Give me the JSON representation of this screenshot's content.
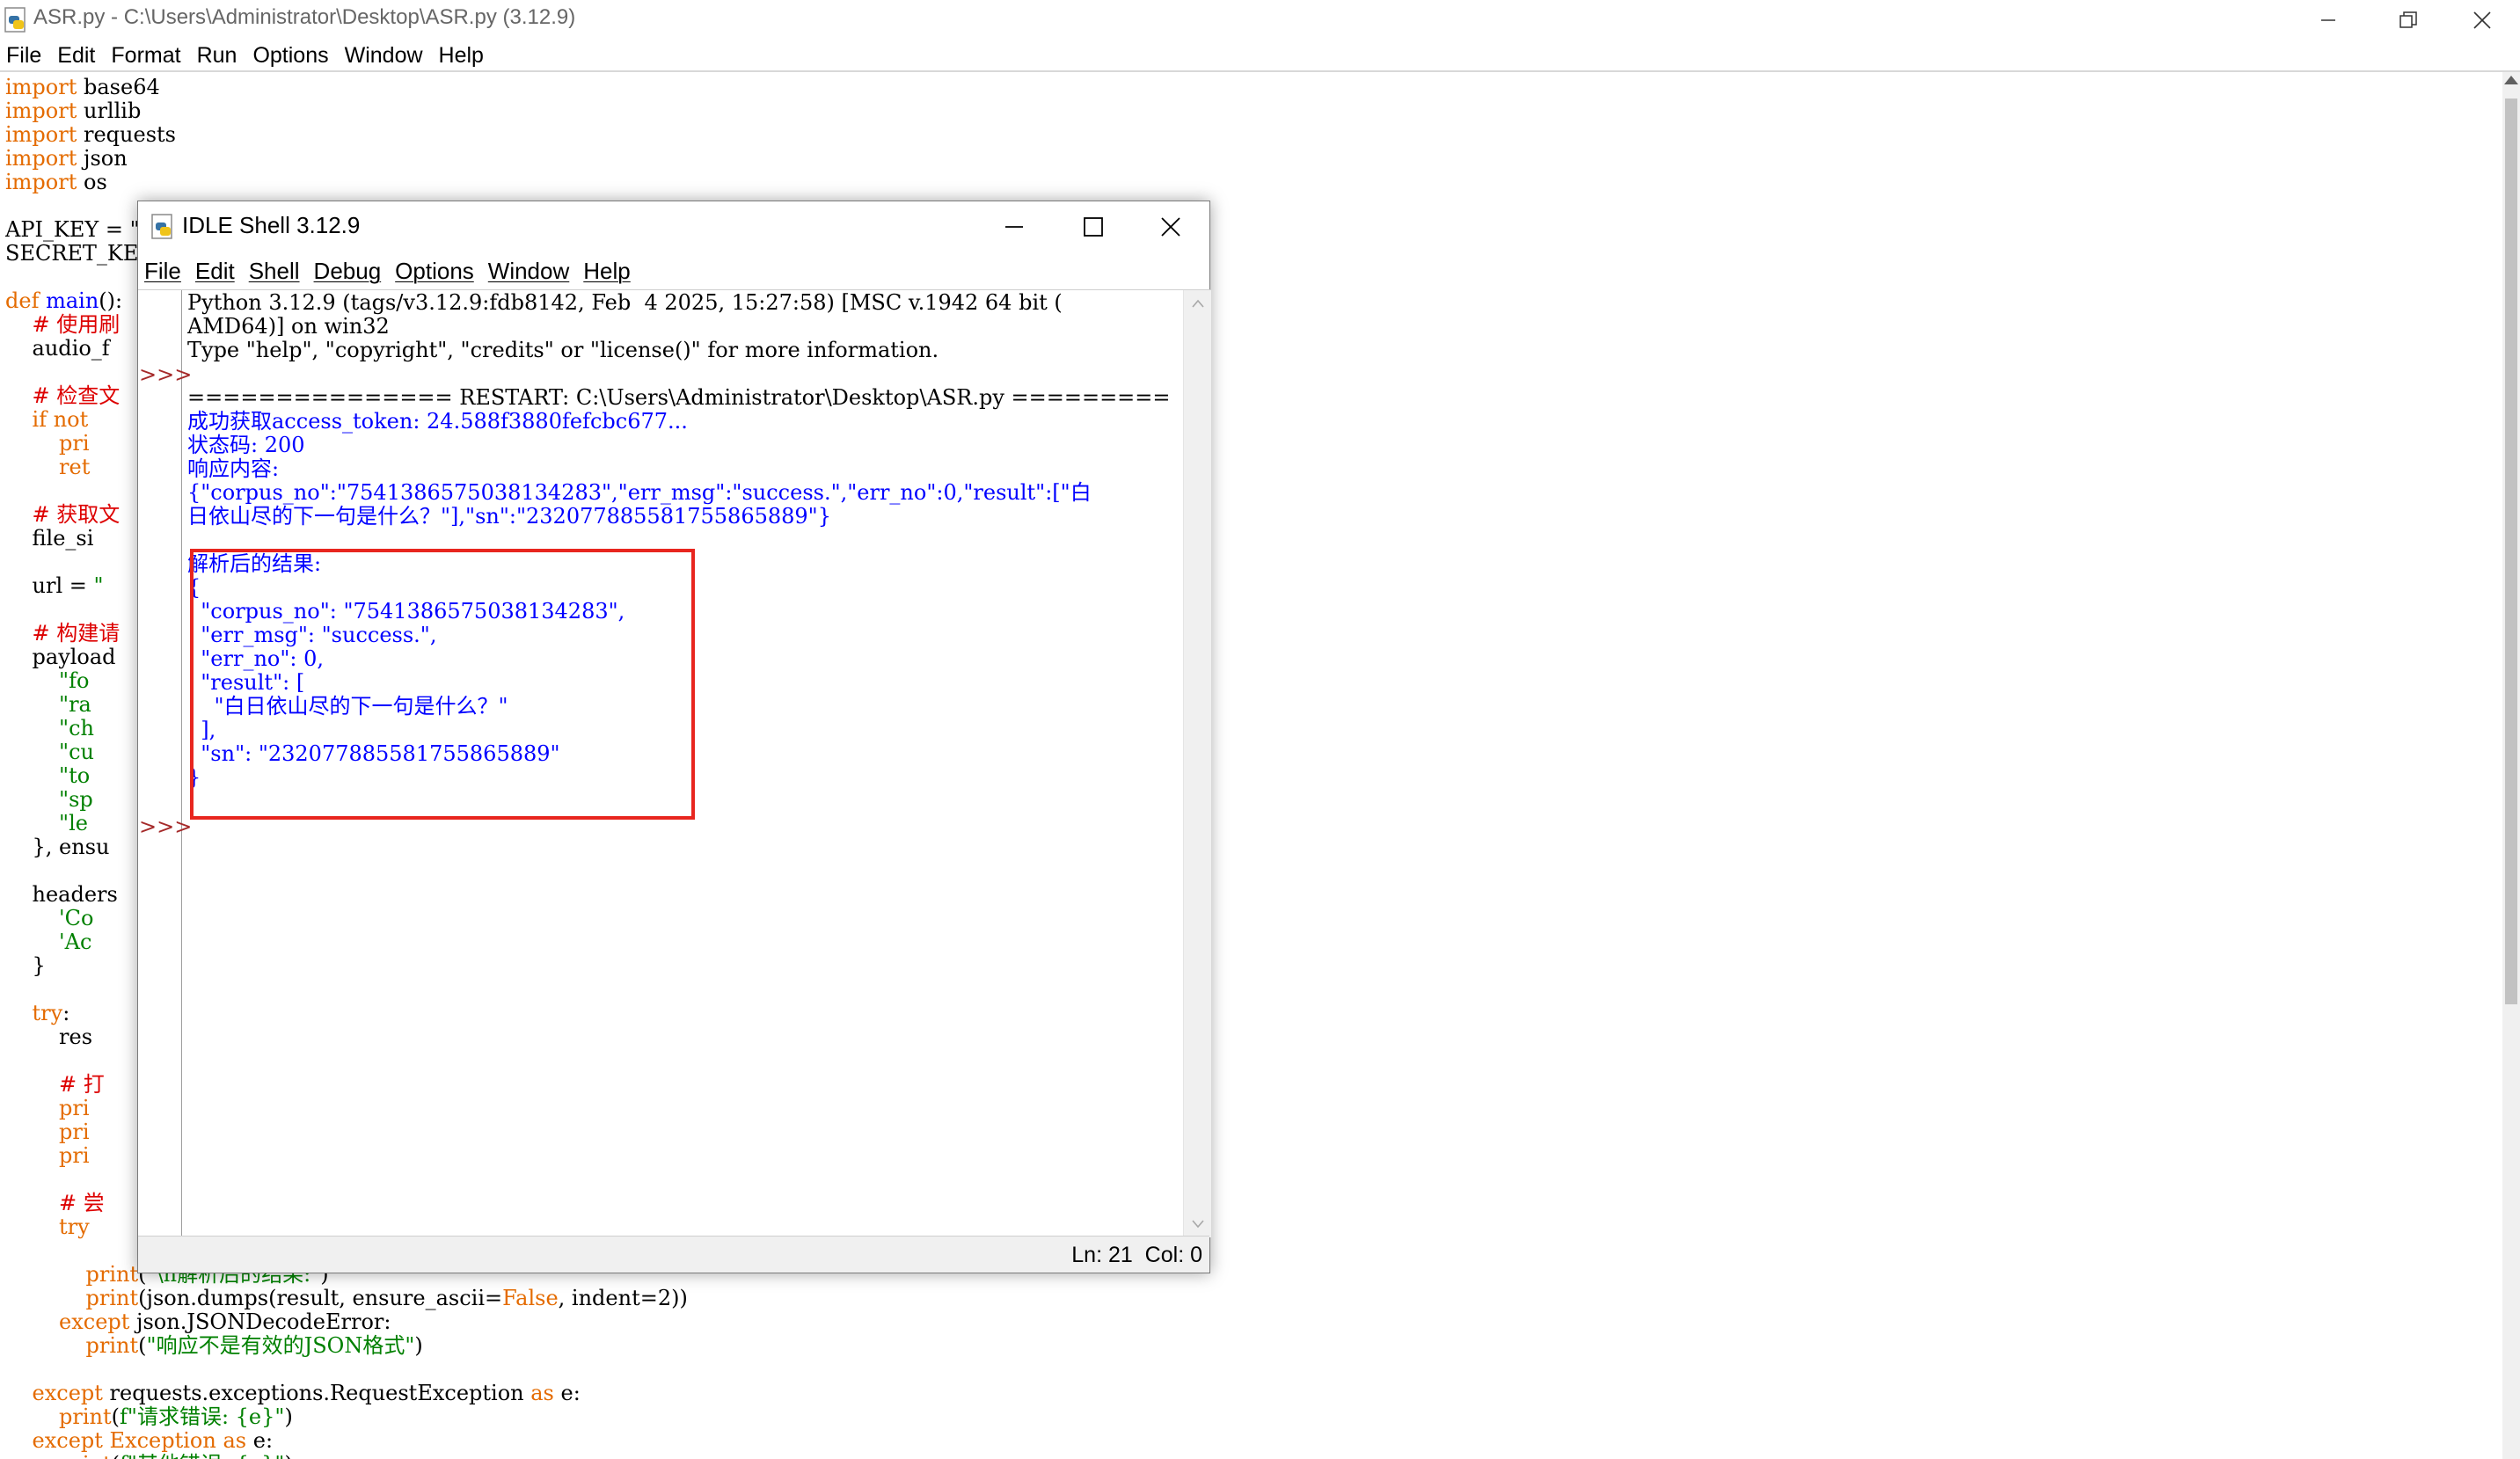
{
  "editor": {
    "title": "ASR.py - C:\\Users\\Administrator\\Desktop\\ASR.py (3.12.9)",
    "menu": [
      "File",
      "Edit",
      "Format",
      "Run",
      "Options",
      "Window",
      "Help"
    ],
    "code_lines": [
      [
        {
          "c": "kw",
          "t": "import"
        },
        {
          "c": "plain",
          "t": " base64"
        }
      ],
      [
        {
          "c": "kw",
          "t": "import"
        },
        {
          "c": "plain",
          "t": " urllib"
        }
      ],
      [
        {
          "c": "kw",
          "t": "import"
        },
        {
          "c": "plain",
          "t": " requests"
        }
      ],
      [
        {
          "c": "kw",
          "t": "import"
        },
        {
          "c": "plain",
          "t": " json"
        }
      ],
      [
        {
          "c": "kw",
          "t": "import"
        },
        {
          "c": "plain",
          "t": " os"
        }
      ],
      [],
      [
        {
          "c": "plain",
          "t": "API_KEY = \""
        }
      ],
      [
        {
          "c": "plain",
          "t": "SECRET_KEY"
        }
      ],
      [],
      [
        {
          "c": "kw",
          "t": "def"
        },
        {
          "c": "plain",
          "t": " "
        },
        {
          "c": "fn",
          "t": "main"
        },
        {
          "c": "plain",
          "t": "():"
        }
      ],
      [
        {
          "c": "cm",
          "t": "    # 使用刷"
        }
      ],
      [
        {
          "c": "plain",
          "t": "    audio_f"
        }
      ],
      [],
      [
        {
          "c": "cm",
          "t": "    # 检查文"
        }
      ],
      [
        {
          "c": "kw",
          "t": "    if not"
        }
      ],
      [
        {
          "c": "kw",
          "t": "        pri"
        }
      ],
      [
        {
          "c": "kw",
          "t": "        ret"
        }
      ],
      [],
      [
        {
          "c": "cm",
          "t": "    # 获取文"
        }
      ],
      [
        {
          "c": "plain",
          "t": "    file_si"
        }
      ],
      [],
      [
        {
          "c": "plain",
          "t": "    url = "
        },
        {
          "c": "st",
          "t": "\""
        }
      ],
      [],
      [
        {
          "c": "cm",
          "t": "    # 构建请"
        }
      ],
      [
        {
          "c": "plain",
          "t": "    payload"
        }
      ],
      [
        {
          "c": "st",
          "t": "        \"fo"
        }
      ],
      [
        {
          "c": "st",
          "t": "        \"ra"
        }
      ],
      [
        {
          "c": "st",
          "t": "        \"ch"
        }
      ],
      [
        {
          "c": "st",
          "t": "        \"cu"
        }
      ],
      [
        {
          "c": "st",
          "t": "        \"to"
        }
      ],
      [
        {
          "c": "st",
          "t": "        \"sp"
        }
      ],
      [
        {
          "c": "st",
          "t": "        \"le"
        }
      ],
      [
        {
          "c": "plain",
          "t": "    }, ensu"
        }
      ],
      [],
      [
        {
          "c": "plain",
          "t": "    headers"
        }
      ],
      [
        {
          "c": "st",
          "t": "        'Co"
        }
      ],
      [
        {
          "c": "st",
          "t": "        'Ac"
        }
      ],
      [
        {
          "c": "plain",
          "t": "    }"
        }
      ],
      [],
      [
        {
          "c": "kw",
          "t": "    try"
        },
        {
          "c": "plain",
          "t": ":"
        }
      ],
      [
        {
          "c": "plain",
          "t": "        res"
        }
      ],
      [],
      [
        {
          "c": "cm",
          "t": "        # 打"
        }
      ],
      [
        {
          "c": "kw",
          "t": "        pri"
        }
      ],
      [
        {
          "c": "kw",
          "t": "        pri"
        }
      ],
      [
        {
          "c": "kw",
          "t": "        pri"
        }
      ],
      [],
      [
        {
          "c": "cm",
          "t": "        # 尝"
        }
      ],
      [
        {
          "c": "kw",
          "t": "        try"
        }
      ],
      [],
      [
        {
          "c": "kw",
          "t": "            print"
        },
        {
          "c": "plain",
          "t": "("
        },
        {
          "c": "st",
          "t": "\"\\n解析后的结果:\""
        },
        {
          "c": "plain",
          "t": ")"
        }
      ],
      [
        {
          "c": "kw",
          "t": "            print"
        },
        {
          "c": "plain",
          "t": "(json.dumps(result, ensure_ascii="
        },
        {
          "c": "kw",
          "t": "False"
        },
        {
          "c": "plain",
          "t": ", indent=2))"
        }
      ],
      [
        {
          "c": "kw",
          "t": "        except"
        },
        {
          "c": "plain",
          "t": " json.JSONDecodeError:"
        }
      ],
      [
        {
          "c": "kw",
          "t": "            print"
        },
        {
          "c": "plain",
          "t": "("
        },
        {
          "c": "st",
          "t": "\"响应不是有效的JSON格式\""
        },
        {
          "c": "plain",
          "t": ")"
        }
      ],
      [],
      [
        {
          "c": "kw",
          "t": "    except"
        },
        {
          "c": "plain",
          "t": " requests.exceptions.RequestException "
        },
        {
          "c": "kw",
          "t": "as"
        },
        {
          "c": "plain",
          "t": " e:"
        }
      ],
      [
        {
          "c": "kw",
          "t": "        print"
        },
        {
          "c": "plain",
          "t": "("
        },
        {
          "c": "st",
          "t": "f\"请求错误: {e}\""
        },
        {
          "c": "plain",
          "t": ")"
        }
      ],
      [
        {
          "c": "kw",
          "t": "    except"
        },
        {
          "c": "plain",
          "t": " "
        },
        {
          "c": "kw",
          "t": "Exception"
        },
        {
          "c": "plain",
          "t": " "
        },
        {
          "c": "kw",
          "t": "as"
        },
        {
          "c": "plain",
          "t": " e:"
        }
      ],
      [
        {
          "c": "kw",
          "t": "        print"
        },
        {
          "c": "plain",
          "t": "("
        },
        {
          "c": "st",
          "t": "f\"其他错误: {e}\""
        },
        {
          "c": "plain",
          "t": ")"
        }
      ]
    ]
  },
  "shell": {
    "title": "IDLE Shell 3.12.9",
    "menu": [
      "File",
      "Edit",
      "Shell",
      "Debug",
      "Options",
      "Window",
      "Help"
    ],
    "prompt": ">>>",
    "output_lines": [
      {
        "c": "out-black",
        "t": "Python 3.12.9 (tags/v3.12.9:fdb8142, Feb  4 2025, 15:27:58) [MSC v.1942 64 bit ("
      },
      {
        "c": "out-black",
        "t": "AMD64)] on win32"
      },
      {
        "c": "out-black",
        "t": "Type \"help\", \"copyright\", \"credits\" or \"license()\" for more information."
      },
      {
        "c": "out-black",
        "t": ""
      },
      {
        "c": "out-black",
        "t": "=============== RESTART: C:\\Users\\Administrator\\Desktop\\ASR.py ==============="
      },
      {
        "c": "out-blue",
        "t": "成功获取access_token: 24.588f3880fefcbc677..."
      },
      {
        "c": "out-blue",
        "t": "状态码: 200"
      },
      {
        "c": "out-blue",
        "t": "响应内容:"
      },
      {
        "c": "out-blue",
        "t": "{\"corpus_no\":\"7541386575038134283\",\"err_msg\":\"success.\",\"err_no\":0,\"result\":[\"白"
      },
      {
        "c": "out-blue",
        "t": "日依山尽的下一句是什么？\"],\"sn\":\"232077885581755865889\"}"
      },
      {
        "c": "out-blue",
        "t": ""
      },
      {
        "c": "out-blue",
        "t": "解析后的结果:"
      },
      {
        "c": "out-blue",
        "t": "{"
      },
      {
        "c": "out-blue",
        "t": "  \"corpus_no\": \"7541386575038134283\","
      },
      {
        "c": "out-blue",
        "t": "  \"err_msg\": \"success.\","
      },
      {
        "c": "out-blue",
        "t": "  \"err_no\": 0,"
      },
      {
        "c": "out-blue",
        "t": "  \"result\": ["
      },
      {
        "c": "out-blue",
        "t": "    \"白日依山尽的下一句是什么？\""
      },
      {
        "c": "out-blue",
        "t": "  ],"
      },
      {
        "c": "out-blue",
        "t": "  \"sn\": \"232077885581755865889\""
      },
      {
        "c": "out-blue",
        "t": "}"
      }
    ],
    "status": "Ln: 21  Col: 0"
  }
}
